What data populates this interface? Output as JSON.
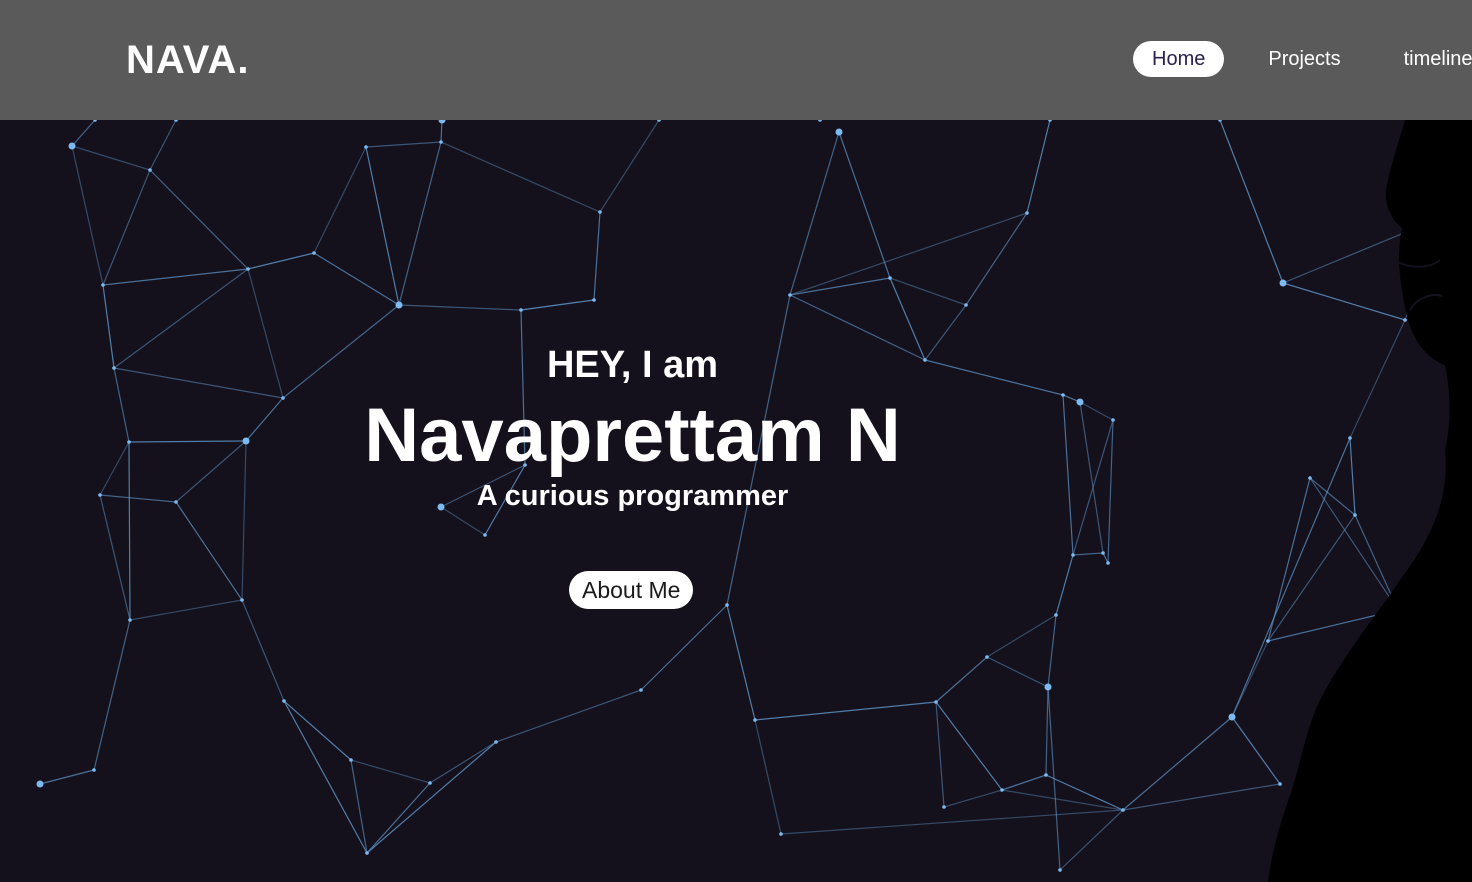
{
  "header": {
    "brand": "NAVA.",
    "nav": [
      {
        "label": "Home",
        "active": true
      },
      {
        "label": "Projects",
        "active": false
      },
      {
        "label": "timeline",
        "active": false
      }
    ]
  },
  "hero": {
    "greeting": "HEY, I am",
    "name": "Navaprettam N",
    "tagline": "A curious programmer",
    "cta_label": "About Me"
  },
  "colors": {
    "header_bg": "#5a5a5a",
    "hero_bg": "#15111c",
    "network_line": "#6aa8e0",
    "nav_active_text": "#2b2150"
  },
  "decor": {
    "background_icon": "particle-network",
    "silhouette_icon": "person-silhouette"
  }
}
